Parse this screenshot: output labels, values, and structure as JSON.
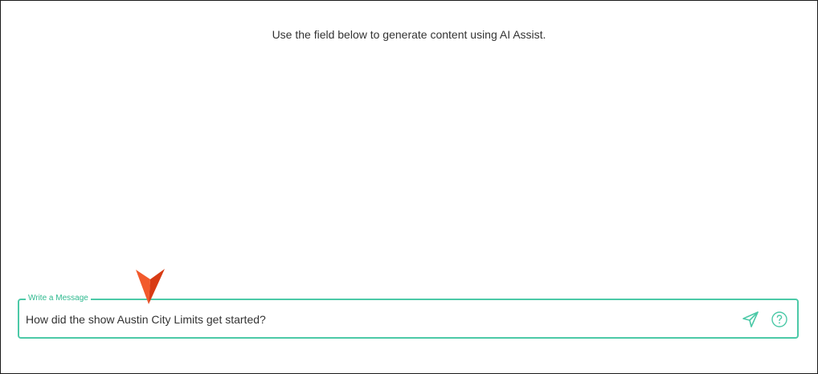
{
  "intro": {
    "text": "Use the field below to generate content using AI Assist."
  },
  "composer": {
    "label": "Write a Message",
    "value": "How did the show Austin City Limits get started?",
    "send_icon": "send-icon",
    "help_icon": "help-circle-icon"
  },
  "colors": {
    "accent": "#4cc9a7",
    "label": "#2fb98f",
    "marker": "#e8451f",
    "text": "#333333"
  }
}
